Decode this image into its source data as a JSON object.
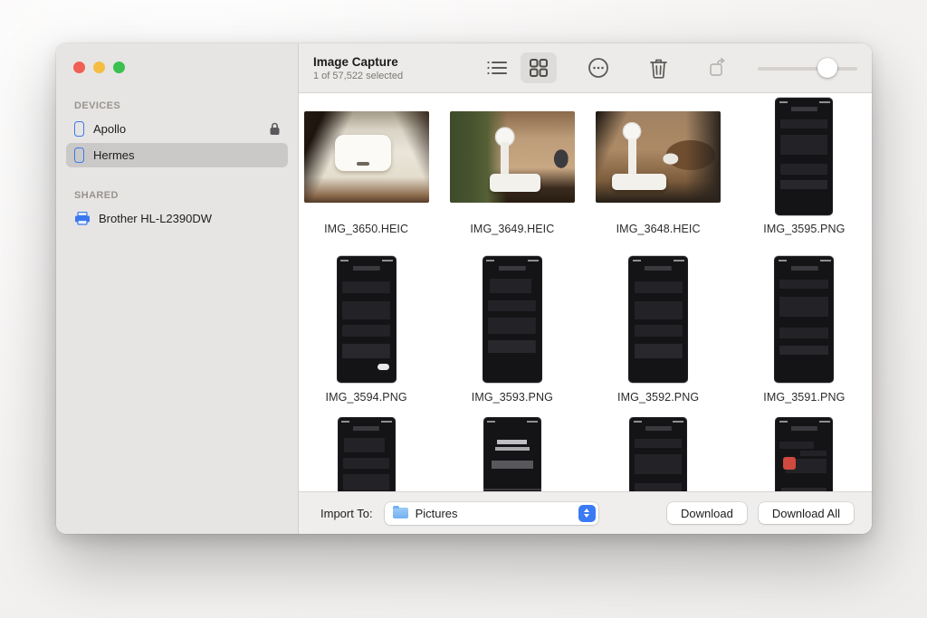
{
  "window": {
    "title": "Image Capture",
    "subtitle": "1 of 57,522 selected"
  },
  "sidebar": {
    "sections": [
      {
        "label": "DEVICES",
        "items": [
          {
            "label": "Apollo",
            "icon": "iphone",
            "locked": true,
            "selected": false
          },
          {
            "label": "Hermes",
            "icon": "iphone",
            "locked": false,
            "selected": true
          }
        ]
      },
      {
        "label": "SHARED",
        "items": [
          {
            "label": "Brother HL-L2390DW",
            "icon": "printer",
            "locked": false,
            "selected": false
          }
        ]
      }
    ]
  },
  "toolbar": {
    "view_buttons": [
      {
        "name": "list-view",
        "selected": false
      },
      {
        "name": "grid-view",
        "selected": true
      }
    ],
    "action_buttons": [
      {
        "name": "more",
        "enabled": true
      },
      {
        "name": "delete",
        "enabled": true
      },
      {
        "name": "rotate",
        "enabled": false
      }
    ],
    "zoom_slider_percent": 72
  },
  "grid": {
    "items": [
      {
        "label": "IMG_3650.HEIC",
        "kind": "photo"
      },
      {
        "label": "IMG_3649.HEIC",
        "kind": "photo"
      },
      {
        "label": "IMG_3648.HEIC",
        "kind": "photo"
      },
      {
        "label": "IMG_3595.PNG",
        "kind": "screenshot"
      },
      {
        "label": "IMG_3594.PNG",
        "kind": "screenshot"
      },
      {
        "label": "IMG_3593.PNG",
        "kind": "screenshot"
      },
      {
        "label": "IMG_3592.PNG",
        "kind": "screenshot"
      },
      {
        "label": "IMG_3591.PNG",
        "kind": "screenshot"
      }
    ],
    "partial_row_thumbnails": 4
  },
  "footer": {
    "import_label": "Import To:",
    "destination": "Pictures",
    "download_label": "Download",
    "download_all_label": "Download All"
  },
  "colors": {
    "accent_blue": "#3a7af5",
    "sidebar_bg": "#e7e5e3",
    "toolbar_bg": "#edebe9",
    "traffic_red": "#f15e55",
    "traffic_yellow": "#f5bd41",
    "traffic_green": "#3ac14e"
  }
}
